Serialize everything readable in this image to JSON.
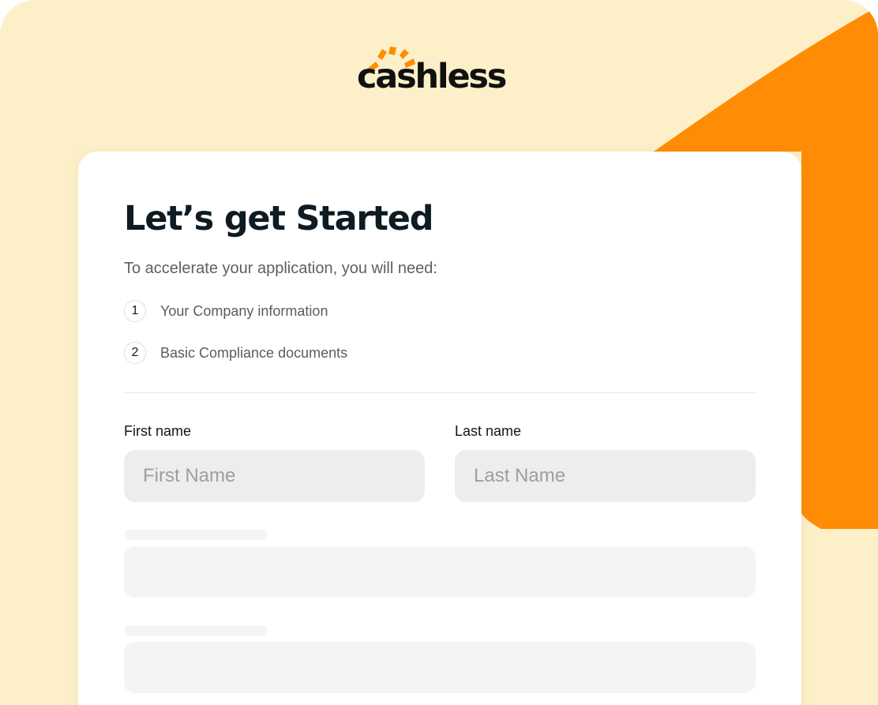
{
  "brand": {
    "name": "cashless",
    "accent_color": "#ff8c05",
    "background_color": "#fdf0c9",
    "logo_icon": "sunburst-logo-icon"
  },
  "card": {
    "title": "Let’s get Started",
    "subtitle": "To accelerate your application, you will need:",
    "requirements": [
      {
        "number": "1",
        "text": "Your Company information"
      },
      {
        "number": "2",
        "text": "Basic Compliance documents"
      }
    ]
  },
  "form": {
    "first_name": {
      "label": "First name",
      "placeholder": "First Name",
      "value": ""
    },
    "last_name": {
      "label": "Last name",
      "placeholder": "Last Name",
      "value": ""
    }
  }
}
